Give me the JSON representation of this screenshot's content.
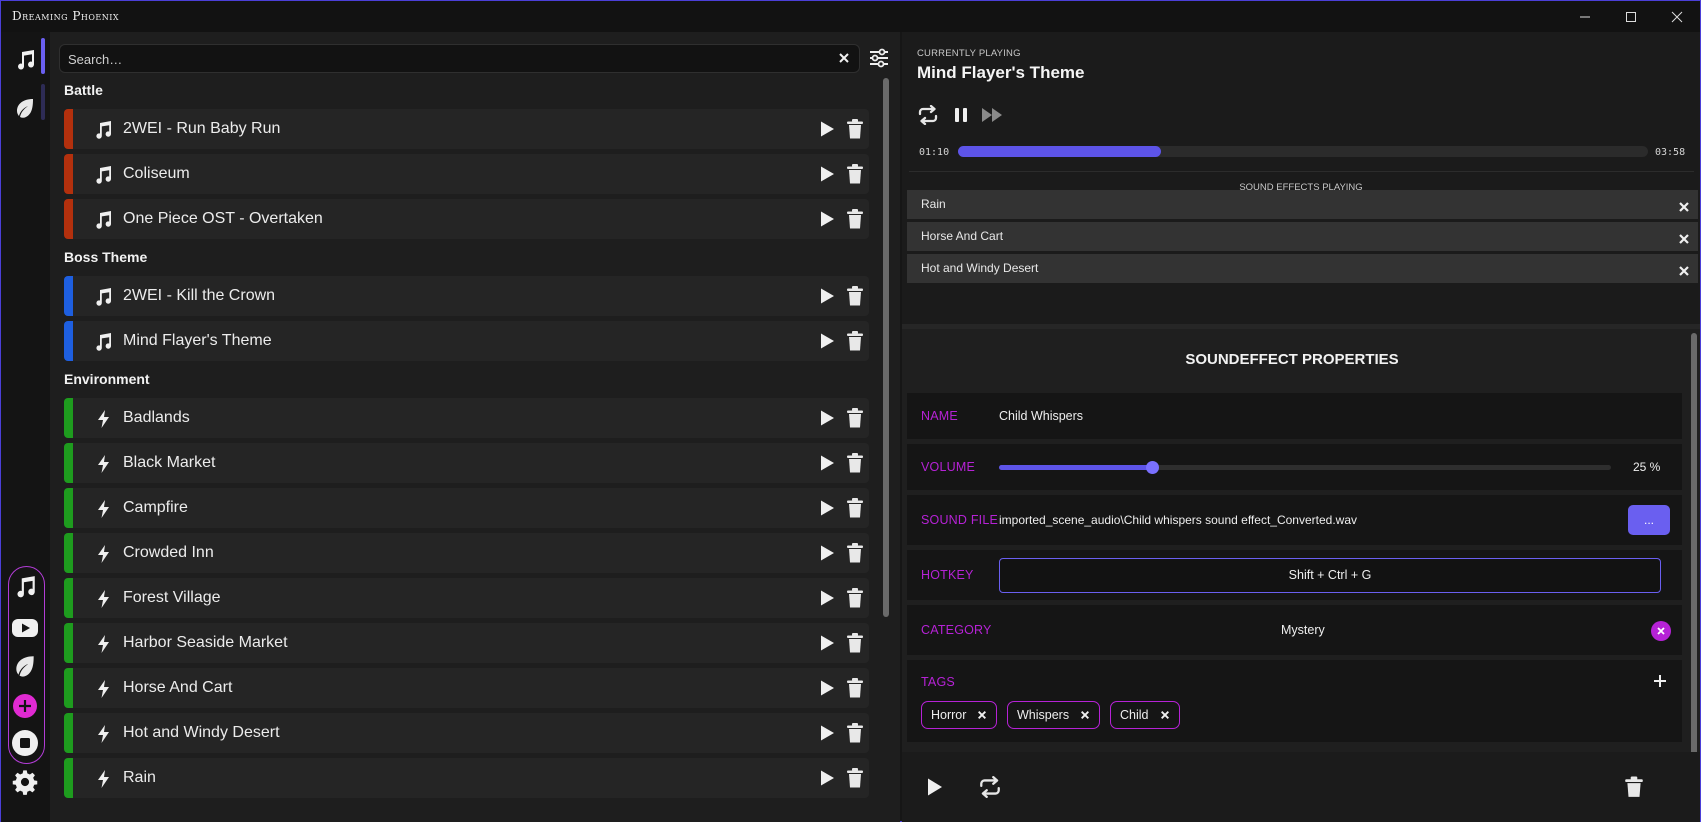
{
  "app": {
    "title": "Dreaming Phoenix"
  },
  "window_controls": {
    "minimize": "—",
    "maximize": "☐",
    "close": "✕"
  },
  "rail": {
    "top_items": [
      {
        "icon": "music-note-icon",
        "active": true
      },
      {
        "icon": "leaf-icon",
        "active": false
      }
    ],
    "group_items": [
      "music-note-icon",
      "youtube-icon",
      "leaf-icon",
      "add-icon"
    ],
    "bottom_items": [
      "stop-icon",
      "gear-icon"
    ]
  },
  "search": {
    "placeholder": "Search…",
    "value": ""
  },
  "colors": {
    "accent": "#5d54e8",
    "magenta": "#b622d6",
    "battle": "#b3300d",
    "boss_theme": "#1e5fe0",
    "environment": "#1e9c1e"
  },
  "library": {
    "categories": [
      {
        "name": "Battle",
        "color": "#b3300d",
        "items": [
          {
            "label": "2WEI - Run Baby Run",
            "icon": "music-note-icon"
          },
          {
            "label": "Coliseum",
            "icon": "music-note-icon"
          },
          {
            "label": "One Piece OST - Overtaken",
            "icon": "music-note-icon"
          }
        ]
      },
      {
        "name": "Boss Theme",
        "color": "#1e5fe0",
        "items": [
          {
            "label": "2WEI - Kill the Crown",
            "icon": "music-note-icon"
          },
          {
            "label": "Mind Flayer's Theme",
            "icon": "music-note-icon"
          }
        ]
      },
      {
        "name": "Environment",
        "color": "#1e9c1e",
        "items": [
          {
            "label": "Badlands",
            "icon": "bolt-icon"
          },
          {
            "label": "Black Market",
            "icon": "bolt-icon"
          },
          {
            "label": "Campfire",
            "icon": "bolt-icon"
          },
          {
            "label": "Crowded Inn",
            "icon": "bolt-icon"
          },
          {
            "label": "Forest Village",
            "icon": "bolt-icon"
          },
          {
            "label": "Harbor Seaside Market",
            "icon": "bolt-icon"
          },
          {
            "label": "Horse And Cart",
            "icon": "bolt-icon"
          },
          {
            "label": "Hot and Windy Desert",
            "icon": "bolt-icon"
          },
          {
            "label": "Rain",
            "icon": "bolt-icon"
          }
        ]
      }
    ]
  },
  "now_playing": {
    "label": "CURRENTLY PLAYING",
    "title": "Mind Flayer's Theme",
    "elapsed": "01:10",
    "duration": "03:58",
    "progress_fraction": 0.294
  },
  "sound_effects": {
    "title": "SOUND EFFECTS PLAYING",
    "items": [
      "Rain",
      "Horse And Cart",
      "Hot and Windy Desert"
    ]
  },
  "properties": {
    "title": "SOUNDEFFECT PROPERTIES",
    "name_label": "NAME",
    "name_value": "Child Whispers",
    "volume_label": "VOLUME",
    "volume_percent": 25,
    "volume_text": "25 %",
    "file_label": "SOUND FILE",
    "file_value": "imported_scene_audio\\Child whispers sound effect_Converted.wav",
    "browse_label": "...",
    "hotkey_label": "HOTKEY",
    "hotkey_value": "Shift + Ctrl + G",
    "category_label": "CATEGORY",
    "category_value": "Mystery",
    "tags_label": "TAGS",
    "tags": [
      "Horror",
      "Whispers",
      "Child"
    ]
  }
}
